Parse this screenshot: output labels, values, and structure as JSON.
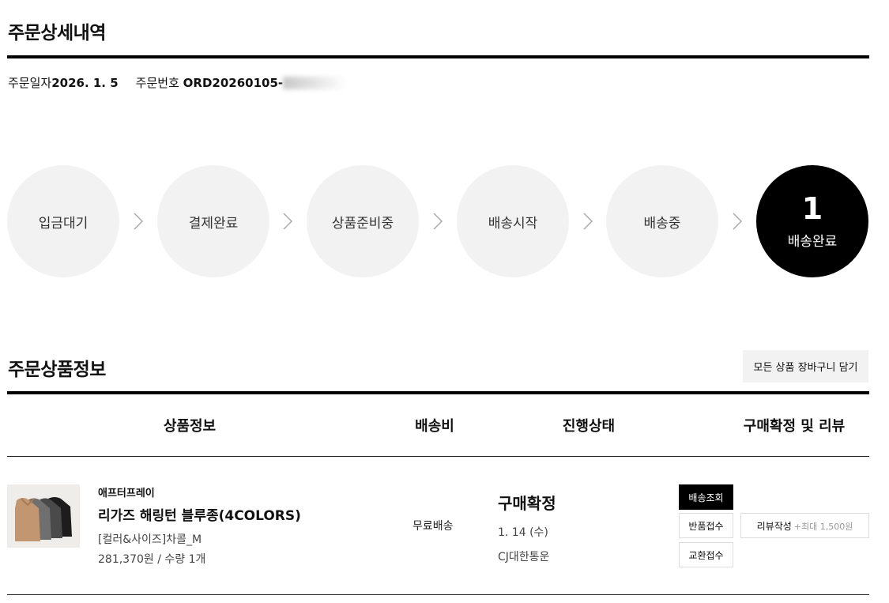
{
  "page": {
    "title": "주문상세내역"
  },
  "order": {
    "date_label": "주문일자",
    "date": "2026. 1. 5",
    "number_label": "주문번호",
    "number": "ORD20260105-"
  },
  "steps": [
    {
      "label": "입금대기"
    },
    {
      "label": "결제완료"
    },
    {
      "label": "상품준비중"
    },
    {
      "label": "배송시작"
    },
    {
      "label": "배송중"
    },
    {
      "label": "배송완료",
      "count": "1"
    }
  ],
  "products_section": {
    "title": "주문상품정보",
    "cart_all_button": "모든 상품 장바구니 담기",
    "headers": [
      "상품정보",
      "배송비",
      "진행상태",
      "구매확정 및 리뷰"
    ]
  },
  "item": {
    "brand": "애프터프레이",
    "name": "리가즈 해링턴 블루종(4COLORS)",
    "option": "[컬러&사이즈]차콜_M",
    "price_qty": "281,370원 / 수량 1개",
    "shipping_fee": "무료배송",
    "status": "구매확정",
    "status_date": "1. 14 (수)",
    "courier": "CJ대한통운",
    "buttons": {
      "track": "배송조회",
      "return": "반품접수",
      "exchange": "교환접수",
      "review": "리뷰작성",
      "review_sub": "+최대 1,500원"
    }
  },
  "colors": {
    "active_step": "#000000",
    "step_bg": "#f2f2f2",
    "accent": "#000000"
  }
}
